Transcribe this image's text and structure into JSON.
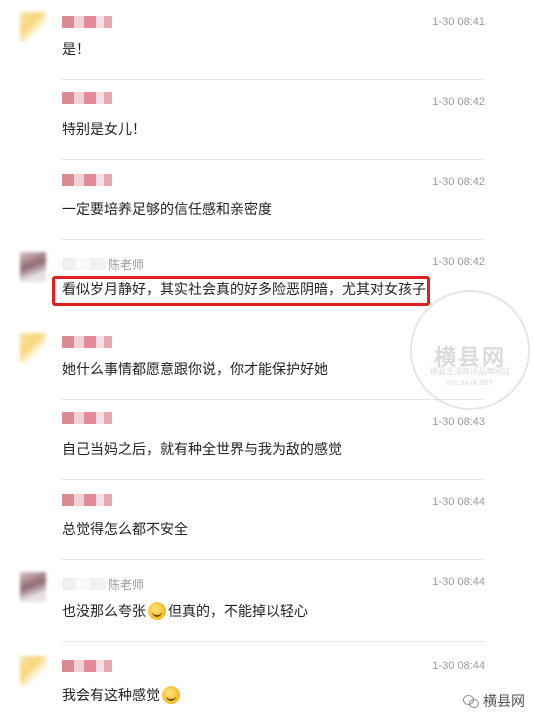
{
  "messages": [
    {
      "author": "",
      "time": "1-30 08:41",
      "text": "是！",
      "avatar": "user"
    },
    {
      "author": "",
      "time": "1-30 08:42",
      "text": "特别是女儿！",
      "avatar": "none"
    },
    {
      "author": "",
      "time": "1-30 08:42",
      "text": "一定要培养足够的信任感和亲密度",
      "avatar": "none"
    },
    {
      "author": "陈老师",
      "time": "1-30 08:42",
      "text": "看似岁月静好，其实社会真的好多险恶阴暗，尤其对女孩子",
      "avatar": "teacher",
      "highlighted": true
    },
    {
      "author": "",
      "time": "",
      "text": "她什么事情都愿意跟你说，你才能保护好她",
      "avatar": "user"
    },
    {
      "author": "",
      "time": "1-30 08:43",
      "text": "自己当妈之后，就有种全世界与我为敌的感觉",
      "avatar": "none"
    },
    {
      "author": "",
      "time": "1-30 08:44",
      "text": "总觉得怎么都不安全",
      "avatar": "none"
    },
    {
      "author": "陈老师",
      "time": "1-30 08:44",
      "text_before": "也没那么夸张",
      "text_after": "但真的，不能掉以轻心",
      "emoji": "facepalm-emoji",
      "avatar": "teacher"
    },
    {
      "author": "",
      "time": "1-30 08:44",
      "text_before": "我会有这种感觉",
      "emoji": "facepalm-emoji",
      "avatar": "user"
    }
  ],
  "watermark": {
    "main": "横县网",
    "sub": "横县生活资讯品牌网站",
    "url": "HXLIHUA.NET"
  },
  "brand": {
    "label": "横县网"
  },
  "colors": {
    "highlight_border": "#e02020",
    "timestamp": "#9b9b9b",
    "divider": "#e8e8e8"
  }
}
